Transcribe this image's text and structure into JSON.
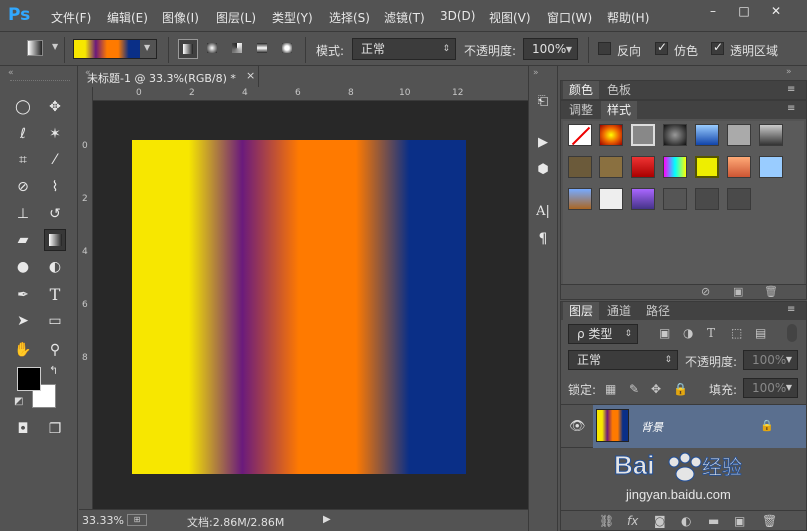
{
  "app": {
    "logo": "Ps",
    "menus": [
      "文件(F)",
      "编辑(E)",
      "图像(I)",
      "图层(L)",
      "类型(Y)",
      "选择(S)",
      "滤镜(T)",
      "3D(D)",
      "视图(V)",
      "窗口(W)",
      "帮助(H)"
    ],
    "window_buttons": [
      "–",
      "□",
      "✕"
    ]
  },
  "options": {
    "mode_label": "模式:",
    "mode_value": "正常",
    "opacity_label": "不透明度:",
    "opacity_value": "100%",
    "reverse_label": "反向",
    "dither_label": "仿色",
    "transparency_label": "透明区域",
    "reverse_checked": false,
    "dither_checked": true,
    "transparency_checked": true
  },
  "document": {
    "tab_title": "未标题-1 @ 33.3%(RGB/8) *",
    "ruler_h": [
      "0",
      "2",
      "4",
      "6",
      "8",
      "10",
      "12"
    ],
    "ruler_v": [
      "0",
      "2",
      "4",
      "6",
      "8"
    ],
    "gradient_colors": [
      "#f7e700",
      "#f7e700",
      "#6a1a7c",
      "#ff7a00",
      "#ff7a00",
      "#0a2f87",
      "#0a2f87"
    ],
    "zoom": "33.33%",
    "doc_info": "文档:2.86M/2.86M"
  },
  "panels": {
    "color_tabs": [
      "颜色",
      "色板"
    ],
    "style_tabs": [
      "调整",
      "样式"
    ],
    "layer_tabs": [
      "图层",
      "通道",
      "路径"
    ],
    "filter_label": "ρ 类型",
    "blend_mode": "正常",
    "opacity_label": "不透明度:",
    "opacity_value": "100%",
    "lock_label": "锁定:",
    "fill_label": "填充:",
    "fill_value": "100%",
    "layer_name": "背景"
  },
  "colors": {
    "foreground": "#000000",
    "background": "#ffffff",
    "accent": "#31a8ff",
    "selected_layer": "#5a6f8f"
  },
  "watermark": "Baidu经验 jingyan.baidu.com"
}
